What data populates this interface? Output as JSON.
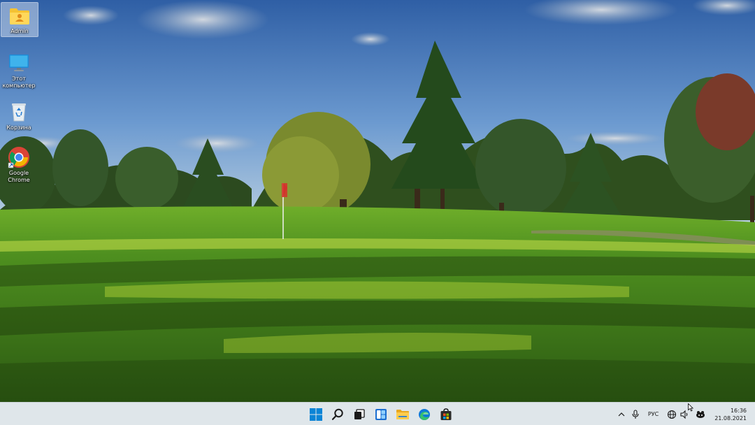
{
  "desktop": {
    "icons": [
      {
        "label": "Admin",
        "icon": "user-folder-icon",
        "selected": true
      },
      {
        "label": "Этот компьютер",
        "icon": "monitor-icon"
      },
      {
        "label": "Корзина",
        "icon": "recycle-bin-icon"
      },
      {
        "label": "Google Chrome",
        "icon": "chrome-icon"
      }
    ]
  },
  "taskbar": {
    "apps": [
      {
        "name": "start-button",
        "icon": "windows-logo-icon"
      },
      {
        "name": "search-button",
        "icon": "search-icon"
      },
      {
        "name": "task-view-button",
        "icon": "task-view-icon"
      },
      {
        "name": "widgets-button",
        "icon": "widgets-icon"
      },
      {
        "name": "file-explorer-button",
        "icon": "folder-icon"
      },
      {
        "name": "edge-button",
        "icon": "edge-icon"
      },
      {
        "name": "store-button",
        "icon": "store-icon"
      }
    ],
    "tray": {
      "language": "РУС",
      "time": "16:36",
      "date": "21.08.2021"
    }
  },
  "colors": {
    "taskbar_bg": "#dfe6ea",
    "windows_blue": "#0078d4",
    "folder_yellow": "#f5c232"
  }
}
